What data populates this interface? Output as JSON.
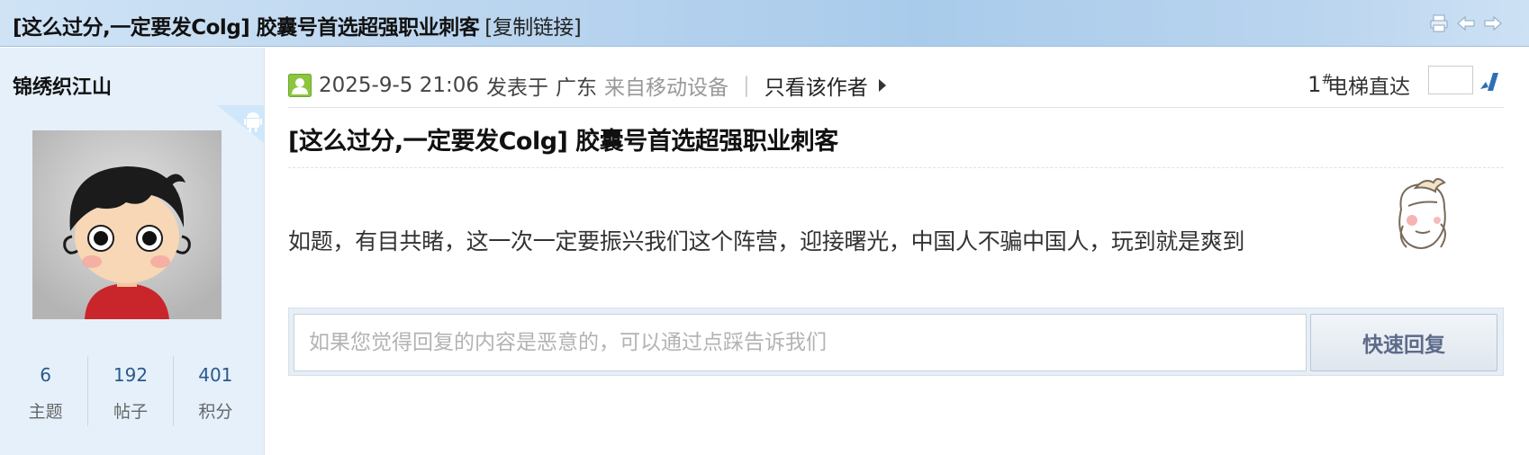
{
  "header": {
    "thread_title": "[这么过分,一定要发Colg] 胶囊号首选超强职业刺客",
    "copy_link_label": "[复制链接]",
    "tool_icons": [
      "print-icon",
      "prev-thread-icon",
      "next-thread-icon"
    ]
  },
  "author": {
    "name": "锦绣织江山",
    "badge_icon": "android-icon",
    "stats": [
      {
        "value": "6",
        "label": "主题"
      },
      {
        "value": "192",
        "label": "帖子"
      },
      {
        "value": "401",
        "label": "积分"
      }
    ]
  },
  "post": {
    "date": "2025-9-5 21:06",
    "posted_label": "发表于",
    "region": "广东",
    "mobile_label": "来自移动设备",
    "separator": "|",
    "only_author_label": "只看该作者",
    "floor": "1",
    "floor_mark": "#",
    "jump_label": "电梯直达",
    "jump_value": "",
    "title": "[这么过分,一定要发Colg] 胶囊号首选超强职业刺客",
    "body": "如题，有目共睹，这一次一定要振兴我们这个阵营，迎接曙光，中国人不骗中国人，玩到就是爽到",
    "sticker_icon": "shy-face-sticker-icon"
  },
  "reply": {
    "placeholder": "如果您觉得回复的内容是恶意的，可以通过点踩告诉我们",
    "value": "",
    "button_label": "快速回复"
  },
  "colors": {
    "title_bar": "#b9d4ee",
    "sidebar_bg": "#e5f0fb",
    "stat_number": "#2a5a8a",
    "online_icon": "#8cc63f",
    "reply_button_text": "#5d6b8a"
  }
}
